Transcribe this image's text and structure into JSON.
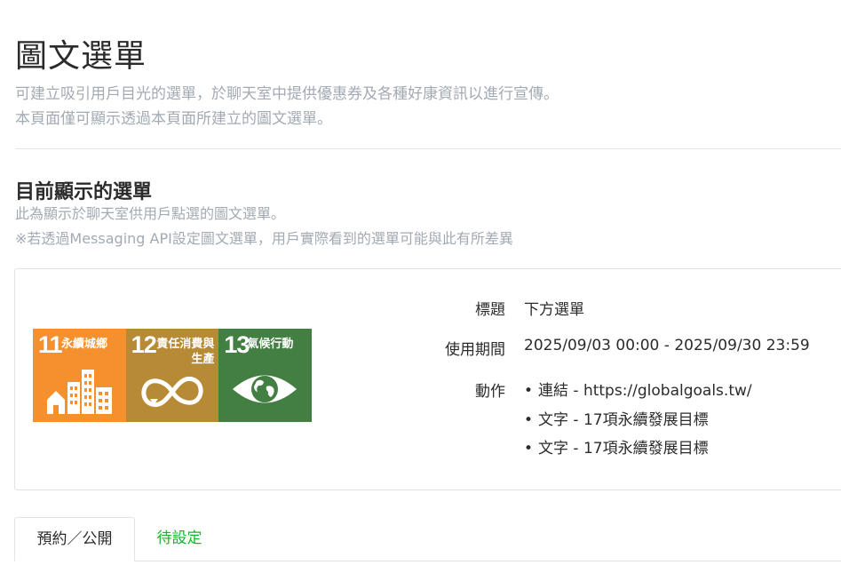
{
  "header": {
    "title": "圖文選單",
    "desc_line1": "可建立吸引用戶目光的選單，於聊天室中提供優惠券及各種好康資訊以進行宣傳。",
    "desc_line2": "本頁面僅可顯示透過本頁面所建立的圖文選單。"
  },
  "current_menu": {
    "title": "目前顯示的選單",
    "desc_line1": "此為顯示於聊天室供用戶點選的圖文選單。",
    "desc_line2": "※若透過Messaging API設定圖文選單，用戶實際看到的選單可能與此有所差異"
  },
  "menu_image": {
    "tiles": [
      {
        "number": "11",
        "text": "永續城鄉",
        "color": "#f4902e",
        "icon": "city-buildings-icon"
      },
      {
        "number": "12",
        "text": "責任消費與生產",
        "color": "#b78a35",
        "icon": "infinity-loop-icon"
      },
      {
        "number": "13",
        "text": "氣候行動",
        "color": "#437e42",
        "icon": "eye-globe-icon"
      }
    ]
  },
  "details": {
    "title_label": "標題",
    "title_value": "下方選單",
    "period_label": "使用期間",
    "period_value": "2025/09/03 00:00 - 2025/09/30 23:59",
    "actions_label": "動作",
    "actions": [
      "連結 - https://globalgoals.tw/",
      "文字 - 17項永續發展目標",
      "文字 - 17項永續發展目標"
    ]
  },
  "tabs": {
    "active": "預約／公開",
    "pending": "待設定"
  },
  "colors": {
    "accent_green": "#19b52b",
    "muted_text": "#a3aab3"
  }
}
